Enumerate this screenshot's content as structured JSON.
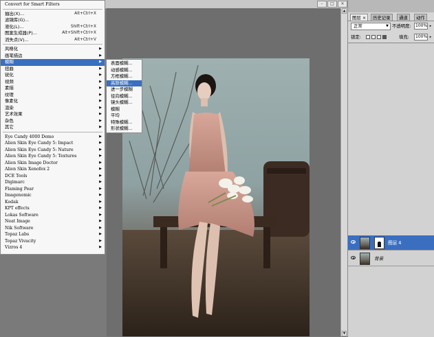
{
  "filter_menu": {
    "items": [
      {
        "label": "Convert for Smart Filters",
        "shortcut": "",
        "arrow": false,
        "mono": true
      },
      {
        "sep": true
      },
      {
        "label": "抽出(X)...",
        "shortcut": "Alt+Ctrl+X",
        "arrow": false
      },
      {
        "label": "滤镜库(G)...",
        "shortcut": "",
        "arrow": false
      },
      {
        "label": "液化(L)...",
        "shortcut": "Shift+Ctrl+X",
        "arrow": false
      },
      {
        "label": "图案生成器(P)...",
        "shortcut": "Alt+Shift+Ctrl+X",
        "arrow": false
      },
      {
        "label": "消失点(V)...",
        "shortcut": "Alt+Ctrl+V",
        "arrow": false
      },
      {
        "sep": true
      },
      {
        "label": "风格化",
        "arrow": true
      },
      {
        "label": "画笔描边",
        "arrow": true
      },
      {
        "label": "模糊",
        "arrow": true,
        "highlighted": true
      },
      {
        "label": "扭曲",
        "arrow": true
      },
      {
        "label": "锐化",
        "arrow": true
      },
      {
        "label": "视频",
        "arrow": true
      },
      {
        "label": "素描",
        "arrow": true
      },
      {
        "label": "纹理",
        "arrow": true
      },
      {
        "label": "像素化",
        "arrow": true
      },
      {
        "label": "渲染",
        "arrow": true
      },
      {
        "label": "艺术效果",
        "arrow": true
      },
      {
        "label": "杂色",
        "arrow": true
      },
      {
        "label": "其它",
        "arrow": true
      },
      {
        "sep": true
      },
      {
        "label": "Eye Candy 4000 Demo",
        "arrow": true,
        "mono": true
      },
      {
        "label": "Alien Skin Eye Candy 5: Impact",
        "arrow": true,
        "mono": true
      },
      {
        "label": "Alien Skin Eye Candy 5: Nature",
        "arrow": true,
        "mono": true
      },
      {
        "label": "Alien Skin Eye Candy 5: Textures",
        "arrow": true,
        "mono": true
      },
      {
        "label": "Alien Skin Image Doctor",
        "arrow": true,
        "mono": true
      },
      {
        "label": "Alien Skin Xenofex 2",
        "arrow": true,
        "mono": true
      },
      {
        "label": "DCE Tools",
        "arrow": true,
        "mono": true
      },
      {
        "label": "Digimarc",
        "arrow": true,
        "mono": true
      },
      {
        "label": "Flaming Pear",
        "arrow": true,
        "mono": true
      },
      {
        "label": "Imagenomic",
        "arrow": true,
        "mono": true
      },
      {
        "label": "Kodak",
        "arrow": true,
        "mono": true
      },
      {
        "label": "KPT effects",
        "arrow": true,
        "mono": true
      },
      {
        "label": "Lokas Software",
        "arrow": true,
        "mono": true
      },
      {
        "label": "Neat Image",
        "arrow": true,
        "mono": true
      },
      {
        "label": "Nik Software",
        "arrow": true,
        "mono": true
      },
      {
        "label": "Topaz Labs",
        "arrow": true,
        "mono": true
      },
      {
        "label": "Topaz Vivacity",
        "arrow": true,
        "mono": true
      },
      {
        "label": "Vizros 4",
        "arrow": true,
        "mono": true
      }
    ]
  },
  "blur_submenu": {
    "items": [
      {
        "label": "表面模糊..."
      },
      {
        "label": "动感模糊..."
      },
      {
        "label": "方框模糊..."
      },
      {
        "label": "高斯模糊...",
        "highlighted": true
      },
      {
        "label": "进一步模糊"
      },
      {
        "label": "径向模糊..."
      },
      {
        "label": "镜头模糊..."
      },
      {
        "label": "模糊"
      },
      {
        "label": "平均"
      },
      {
        "label": "特殊模糊..."
      },
      {
        "label": "形状模糊..."
      }
    ]
  },
  "layers_panel": {
    "tabs": [
      "图层 ×",
      "历史记录",
      "通道",
      "动作"
    ],
    "blend_mode": "正常",
    "opacity_label": "不透明度:",
    "opacity_value": "100%",
    "lock_label": "锁定:",
    "fill_label": "填充:",
    "fill_value": "100%",
    "layers": [
      {
        "name": "图层 4",
        "selected": true,
        "has_mask": true
      },
      {
        "name": "背景",
        "selected": false,
        "has_mask": false
      }
    ]
  },
  "colors": {
    "highlight": "#3a6fc0"
  }
}
